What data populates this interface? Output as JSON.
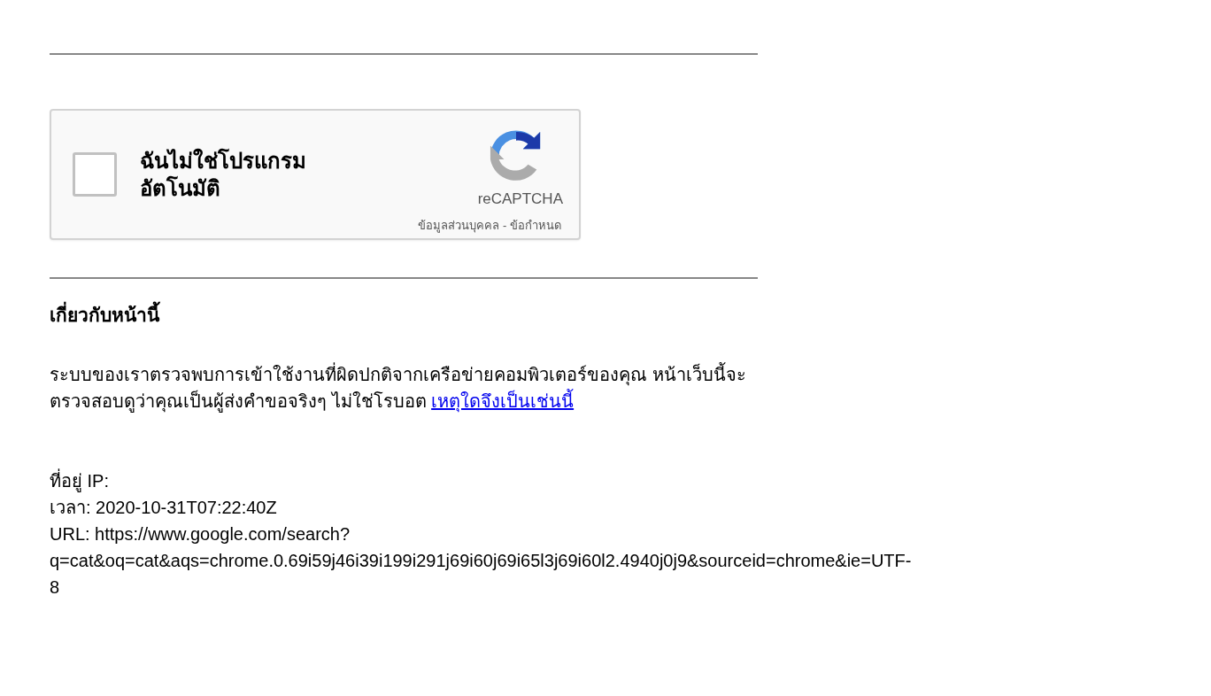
{
  "captcha": {
    "checked": false,
    "label_lines": [
      "ฉันไม่ใช่โปรแกรม",
      "อัตโนมัติ"
    ],
    "brand": "reCAPTCHA",
    "privacy_link": "ข้อมูลส่วนบุคคล",
    "separator": " - ",
    "terms_link": "ข้อกำหนด"
  },
  "about": {
    "heading": "เกี่ยวกับหน้านี้",
    "text": "ระบบของเราตรวจพบการเข้าใช้งานที่ผิดปกติจากเครือข่ายคอมพิวเตอร์ของคุณ หน้าเว็บนี้จะตรวจสอบดูว่าคุณเป็นผู้ส่งคำขอจริงๆ ไม่ใช่โรบอต",
    "link": "เหตุใดจึงเป็นเช่นนี้"
  },
  "info_lines": [
    "ที่อยู่ IP:",
    "เวลา: 2020-10-31T07:22:40Z",
    "URL: https://www.google.com/search?",
    "q=cat&oq=cat&aqs=chrome.0.69i59j46i39i199i291j69i60j69i65l3j69i60l2.4940j0j9&sourceid=chrome&ie=UTF-",
    "8"
  ]
}
